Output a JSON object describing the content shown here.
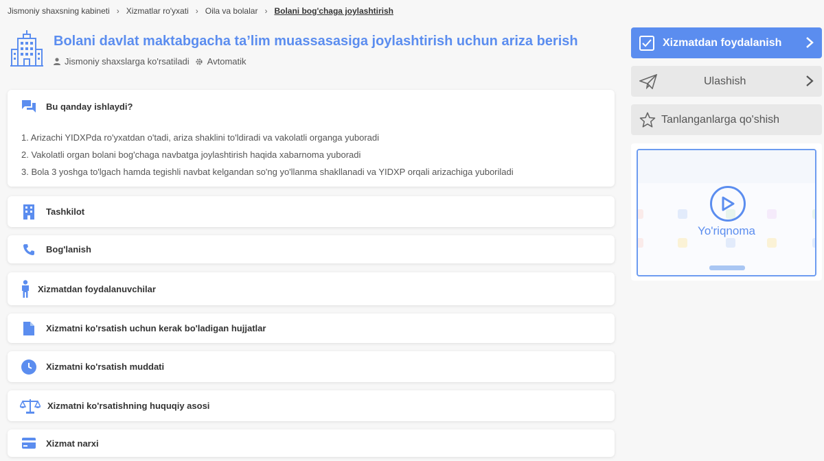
{
  "breadcrumb": [
    {
      "label": "Jismoniy shaxsning kabineti"
    },
    {
      "label": "Xizmatlar ro'yxati"
    },
    {
      "label": "Oila va bolalar"
    },
    {
      "label": "Bolani bog'chaga joylashtirish"
    }
  ],
  "breadcrumb_separator": "›",
  "service": {
    "title": "Bolani davlat maktabgacha ta’lim muassasasiga joylashtirish uchun ariza berish",
    "audience": "Jismoniy shaxslarga ko'rsatiladi",
    "mode": "Avtomatik"
  },
  "how_it_works": {
    "title": "Bu qanday ishlaydi?",
    "steps": [
      "1. Arizachi YIDXPda ro'yxatdan o'tadi, ariza shaklini to'ldiradi va vakolatli organga yuboradi",
      "2. Vakolatli organ bolani bog'chaga navbatga joylashtirish haqida xabarnoma yuboradi",
      "3. Bola 3 yoshga to'lgach hamda tegishli navbat kelgandan so'ng yo'llanma shakllanadi va YIDXP orqali arizachiga yuboriladi"
    ]
  },
  "sections": [
    {
      "label": "Tashkilot",
      "icon": "building-icon"
    },
    {
      "label": "Bog'lanish",
      "icon": "phone-icon"
    },
    {
      "label": "Xizmatdan foydalanuvchilar",
      "icon": "person-icon"
    },
    {
      "label": "Xizmatni ko'rsatish uchun kerak bo'ladigan hujjatlar",
      "icon": "document-icon"
    },
    {
      "label": "Xizmatni ko'rsatish muddati",
      "icon": "clock-icon"
    },
    {
      "label": "Xizmatni ko'rsatishning huquqiy asosi",
      "icon": "scales-icon"
    },
    {
      "label": "Xizmat narxi",
      "icon": "credit-card-icon"
    }
  ],
  "sidebar": {
    "use_service": "Xizmatdan foydalanish",
    "share": "Ulashish",
    "favorite": "Tanlanganlarga qo'shish",
    "video_label": "Yo'riqnoma"
  },
  "colors": {
    "accent": "#5b8def",
    "background": "#f7f7f7",
    "secondary_button": "#e8e8e8"
  }
}
